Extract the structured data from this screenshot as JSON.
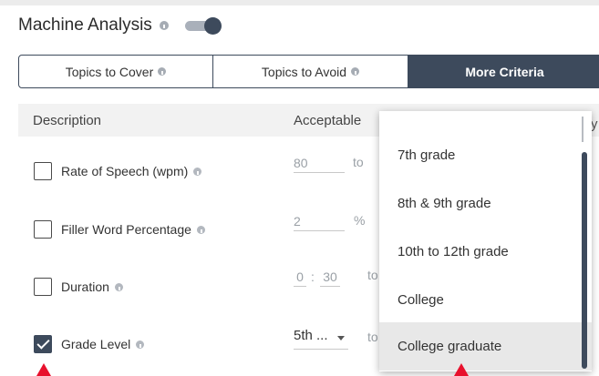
{
  "header": {
    "title": "Machine Analysis",
    "toggle_on": true
  },
  "tabs": [
    {
      "label": "Topics to Cover",
      "active": false
    },
    {
      "label": "Topics to Avoid",
      "active": false
    },
    {
      "label": "More Criteria",
      "active": true
    }
  ],
  "table": {
    "col_description": "Description",
    "col_acceptable": "Acceptable",
    "rows": [
      {
        "label": "Rate of Speech (wpm)",
        "checked": false,
        "value": "80",
        "unit": "to"
      },
      {
        "label": "Filler Word Percentage",
        "checked": false,
        "value": "2",
        "unit": "%"
      },
      {
        "label": "Duration",
        "checked": false,
        "minutes": "0",
        "separator": ":",
        "seconds": "30",
        "unit": "to"
      },
      {
        "label": "Grade Level",
        "checked": true,
        "select_value": "5th ...",
        "unit": "to"
      }
    ]
  },
  "dropdown": {
    "items": [
      "7th grade",
      "8th & 9th grade",
      "10th to 12th grade",
      "College",
      "College graduate"
    ],
    "selected": "College graduate",
    "right_edge_glyph": "y"
  },
  "colors": {
    "accent_dark": "#3d4a5c",
    "marker_red": "#e8112d"
  }
}
